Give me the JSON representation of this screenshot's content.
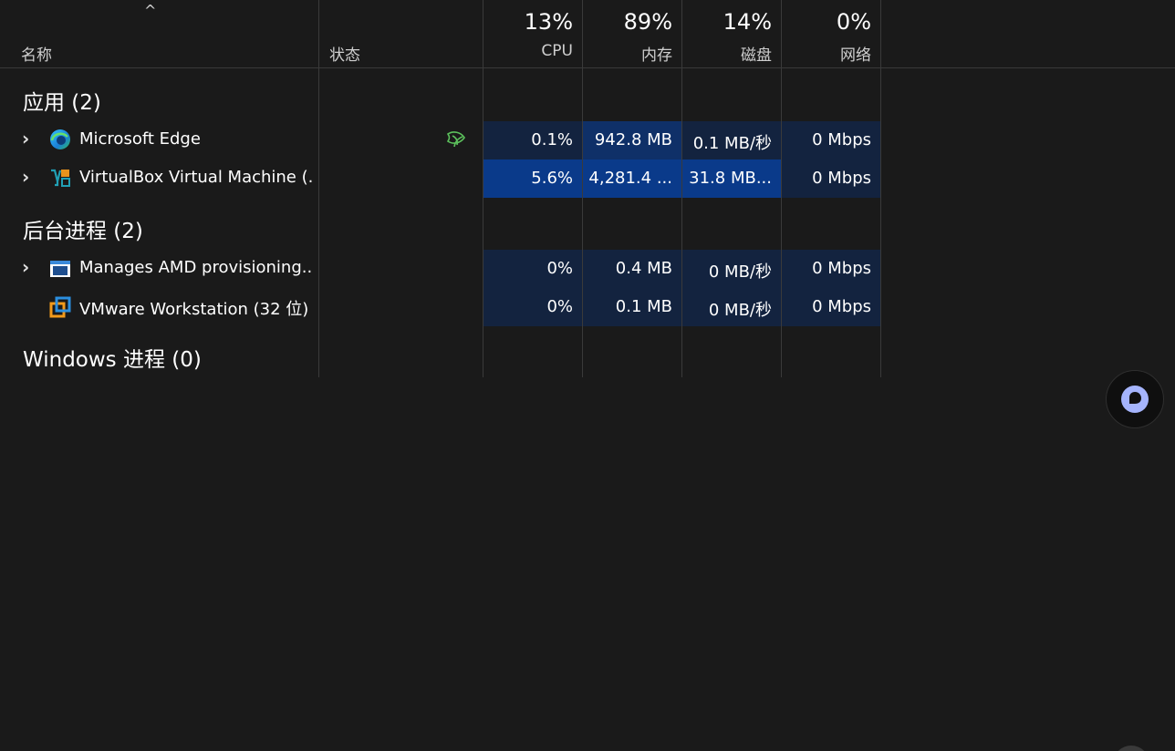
{
  "header": {
    "sort_caret": "^",
    "columns": {
      "name": "名称",
      "status": "状态",
      "cpu": {
        "pct": "13%",
        "label": "CPU"
      },
      "memory": {
        "pct": "89%",
        "label": "内存"
      },
      "disk": {
        "pct": "14%",
        "label": "磁盘"
      },
      "network": {
        "pct": "0%",
        "label": "网络"
      }
    }
  },
  "sections": {
    "apps": "应用 (2)",
    "background": "后台进程 (2)",
    "windows": "Windows 进程 (0)"
  },
  "rows": [
    {
      "name": "Microsoft Edge",
      "cpu": "0.1%",
      "memory": "942.8 MB",
      "disk": "0.1 MB/秒",
      "network": "0 Mbps",
      "icon": "edge-icon",
      "status_icon": "efficiency-leaf-icon"
    },
    {
      "name": "VirtualBox Virtual Machine (...",
      "cpu": "5.6%",
      "memory": "4,281.4 ...",
      "disk": "31.8 MB...",
      "network": "0 Mbps",
      "icon": "virtualbox-icon"
    },
    {
      "name": "Manages AMD provisioning...",
      "cpu": "0%",
      "memory": "0.4 MB",
      "disk": "0 MB/秒",
      "network": "0 Mbps",
      "icon": "app-window-icon"
    },
    {
      "name": "VMware Workstation (32 位)",
      "cpu": "0%",
      "memory": "0.1 MB",
      "disk": "0 MB/秒",
      "network": "0 Mbps",
      "icon": "vmware-icon"
    }
  ],
  "colors": {
    "background": "#1a1a1a",
    "heat_low": "#13233f",
    "heat_mid": "#0f3068",
    "heat_high": "#0a3a8a",
    "leaf_green": "#5cc05c",
    "assistant_accent": "#a5b4fc"
  },
  "floating": {
    "icon": "assistant-chat-icon"
  }
}
